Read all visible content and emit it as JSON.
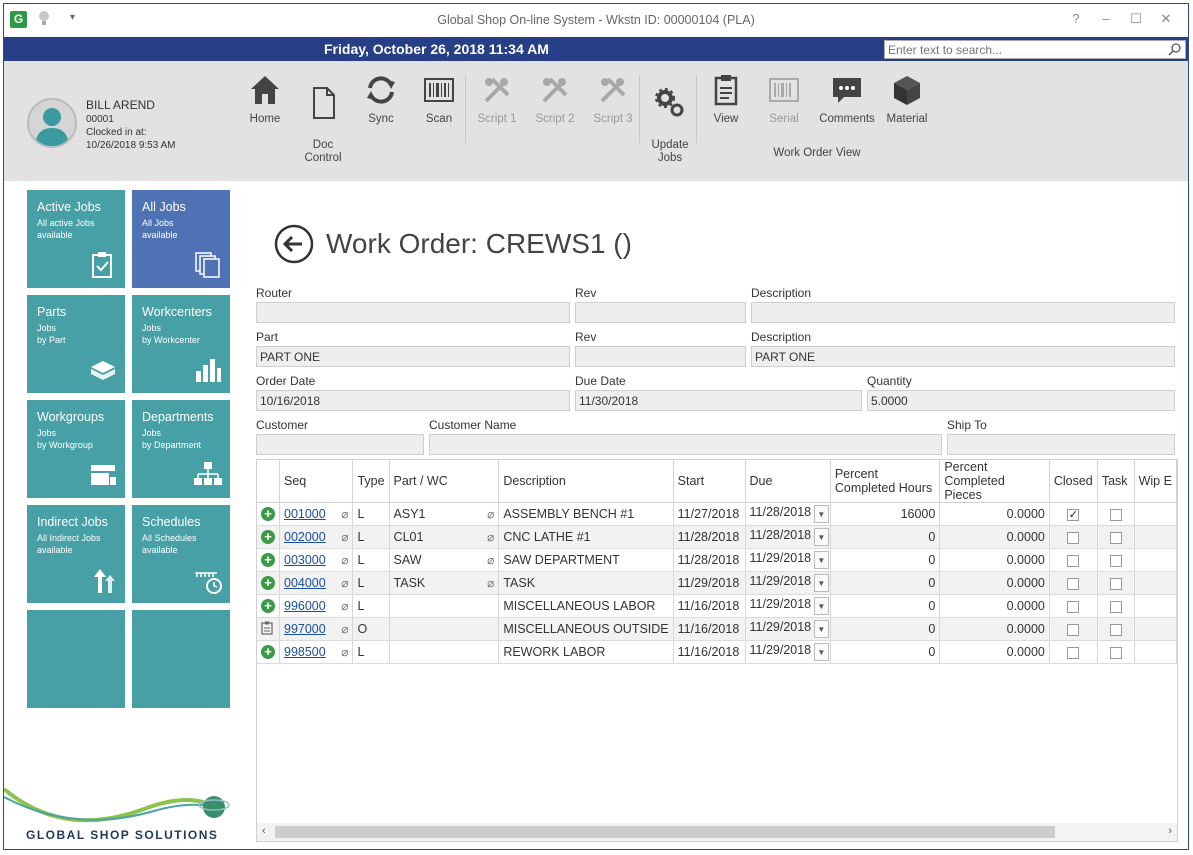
{
  "window": {
    "title": "Global Shop On-line System - Wkstn ID: 00000104 (PLA)",
    "controls": {
      "help": "?",
      "minimize": "–",
      "maximize": "☐",
      "close": "✕"
    }
  },
  "datebar": {
    "datetime": "Friday, October 26, 2018 11:34 AM",
    "search_placeholder": "Enter text to search..."
  },
  "user": {
    "name": "BILL AREND",
    "id": "00001",
    "clocked_label": "Clocked in at:",
    "clocked_time": "10/26/2018 9:53 AM"
  },
  "ribbon": {
    "buttons": [
      {
        "label": "Home",
        "icon": "home-icon",
        "enabled": true
      },
      {
        "label": "Doc\nControl",
        "icon": "document-icon",
        "enabled": true
      },
      {
        "label": "Sync",
        "icon": "sync-icon",
        "enabled": true
      },
      {
        "label": "Scan",
        "icon": "barcode-icon",
        "enabled": true
      },
      {
        "label": "Script 1",
        "icon": "tools-icon",
        "enabled": false
      },
      {
        "label": "Script 2",
        "icon": "tools-icon",
        "enabled": false
      },
      {
        "label": "Script 3",
        "icon": "tools-icon",
        "enabled": false
      },
      {
        "label": "Update\nJobs",
        "icon": "gears-icon",
        "enabled": true
      },
      {
        "label": "View",
        "icon": "clipboard-icon",
        "enabled": true
      },
      {
        "label": "Serial",
        "icon": "serial-icon",
        "enabled": false
      },
      {
        "label": "Comments",
        "icon": "comments-icon",
        "enabled": true
      },
      {
        "label": "Material",
        "icon": "cube-icon",
        "enabled": true
      }
    ],
    "group_label": "Work Order View"
  },
  "tiles": [
    {
      "title": "Active Jobs",
      "sub": "All active Jobs\navailable",
      "icon": "clipboard-check-icon",
      "selected": false
    },
    {
      "title": "All Jobs",
      "sub": "All Jobs\navailable",
      "icon": "stacked-docs-icon",
      "selected": true
    },
    {
      "title": "Parts",
      "sub": "Jobs\nby Part",
      "icon": "box-icon",
      "selected": false
    },
    {
      "title": "Workcenters",
      "sub": "Jobs\nby Workcenter",
      "icon": "factory-icon",
      "selected": false
    },
    {
      "title": "Workgroups",
      "sub": "Jobs\nby Workgroup",
      "icon": "workgroup-icon",
      "selected": false
    },
    {
      "title": "Departments",
      "sub": "Jobs\nby Department",
      "icon": "org-chart-icon",
      "selected": false
    },
    {
      "title": "Indirect Jobs",
      "sub": "All Indirect Jobs\navailable",
      "icon": "arrows-up-icon",
      "selected": false
    },
    {
      "title": "Schedules",
      "sub": "All Schedules\navailable",
      "icon": "schedule-icon",
      "selected": false
    },
    {
      "title": "",
      "sub": "",
      "icon": "",
      "selected": false
    },
    {
      "title": "",
      "sub": "",
      "icon": "",
      "selected": false
    }
  ],
  "brand": {
    "name": "GLOBAL SHOP SOLUTIONS"
  },
  "page": {
    "title": "Work Order: CREWS1 ()"
  },
  "form": {
    "router_label": "Router",
    "router_value": "",
    "rev1_label": "Rev",
    "rev1_value": "",
    "desc1_label": "Description",
    "desc1_value": "",
    "part_label": "Part",
    "part_value": "PART ONE",
    "rev2_label": "Rev",
    "rev2_value": "",
    "desc2_label": "Description",
    "desc2_value": "PART ONE",
    "order_date_label": "Order Date",
    "order_date_value": "10/16/2018",
    "due_date_label": "Due Date",
    "due_date_value": "11/30/2018",
    "quantity_label": "Quantity",
    "quantity_value": "5.0000",
    "customer_label": "Customer",
    "customer_value": "",
    "customer_name_label": "Customer Name",
    "customer_name_value": "",
    "ship_to_label": "Ship To",
    "ship_to_value": ""
  },
  "grid": {
    "columns": [
      "",
      "Seq",
      "Type",
      "Part / WC",
      "Description",
      "Start",
      "Due",
      "Percent Completed Hours",
      "Percent Completed Pieces",
      "Closed",
      "Task",
      "Wip E"
    ],
    "rows": [
      {
        "icon": "add-icon",
        "seq": "001000",
        "type": "L",
        "part_wc": "ASY1",
        "part_clip": true,
        "description": "ASSEMBLY BENCH #1",
        "start": "11/27/2018",
        "due": "11/28/2018",
        "pct_hours": "16000",
        "pct_pieces": "0.0000",
        "closed": true,
        "task": false
      },
      {
        "icon": "add-icon",
        "seq": "002000",
        "type": "L",
        "part_wc": "CL01",
        "part_clip": true,
        "description": "CNC LATHE #1",
        "start": "11/28/2018",
        "due": "11/28/2018",
        "pct_hours": "0",
        "pct_pieces": "0.0000",
        "closed": false,
        "task": false
      },
      {
        "icon": "add-icon",
        "seq": "003000",
        "type": "L",
        "part_wc": "SAW",
        "part_clip": true,
        "description": "SAW DEPARTMENT",
        "start": "11/28/2018",
        "due": "11/29/2018",
        "pct_hours": "0",
        "pct_pieces": "0.0000",
        "closed": false,
        "task": false
      },
      {
        "icon": "add-icon",
        "seq": "004000",
        "type": "L",
        "part_wc": "TASK",
        "part_clip": true,
        "description": "TASK",
        "start": "11/29/2018",
        "due": "11/29/2018",
        "pct_hours": "0",
        "pct_pieces": "0.0000",
        "closed": false,
        "task": false
      },
      {
        "icon": "add-icon",
        "seq": "996000",
        "type": "L",
        "part_wc": "",
        "part_clip": false,
        "description": "MISCELLANEOUS LABOR",
        "start": "11/16/2018",
        "due": "11/29/2018",
        "pct_hours": "0",
        "pct_pieces": "0.0000",
        "closed": false,
        "task": false
      },
      {
        "icon": "outside-icon",
        "seq": "997000",
        "type": "O",
        "part_wc": "",
        "part_clip": false,
        "description": "MISCELLANEOUS OUTSIDE",
        "start": "11/16/2018",
        "due": "11/29/2018",
        "pct_hours": "0",
        "pct_pieces": "0.0000",
        "closed": false,
        "task": false
      },
      {
        "icon": "add-icon",
        "seq": "998500",
        "type": "L",
        "part_wc": "",
        "part_clip": false,
        "description": "REWORK LABOR",
        "start": "11/16/2018",
        "due": "11/29/2018",
        "pct_hours": "0",
        "pct_pieces": "0.0000",
        "closed": false,
        "task": false
      }
    ]
  }
}
